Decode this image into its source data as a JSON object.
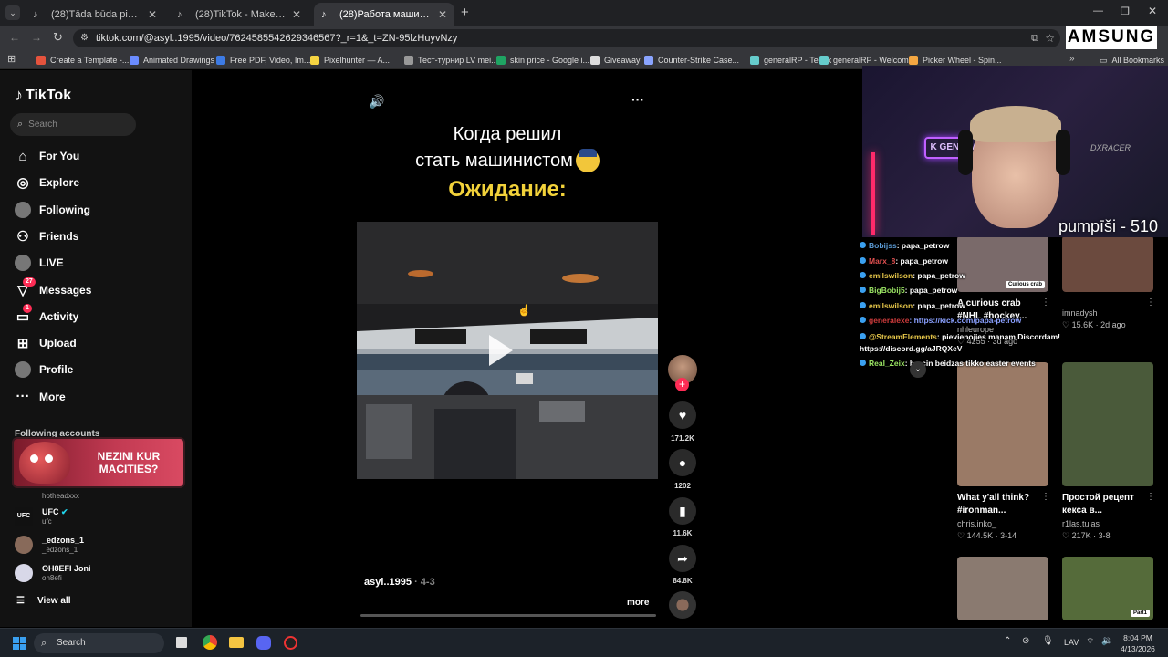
{
  "browser": {
    "tabs": [
      {
        "title": "(28)Tāda būda pienāca #fyp #v",
        "active": false
      },
      {
        "title": "(28)TikTok - Make Your Day",
        "active": false
      },
      {
        "title": "(28)Работа машиниста: реаль",
        "active": true
      }
    ],
    "url": "tiktok.com/@asyl..1995/video/7624585542629346567?_r=1&_t=ZN-95lzHuyvNzy",
    "bookmarks": [
      {
        "label": "Create a Template -...",
        "color": "#e5533d"
      },
      {
        "label": "Animated Drawings",
        "color": "#6b8cff"
      },
      {
        "label": "Free PDF, Video, Im...",
        "color": "#3d7be5"
      },
      {
        "label": "Pixelhunter — A...",
        "color": "#f5d442"
      },
      {
        "label": "Тест-турнир LV mei...",
        "color": "#999"
      },
      {
        "label": "skin price - Google i...",
        "color": "#1fa463"
      },
      {
        "label": "Giveaway",
        "color": "#ddd"
      },
      {
        "label": "Counter-Strike Case...",
        "color": "#8aa4ff"
      },
      {
        "label": "generalRP - Tebex",
        "color": "#6cc"
      },
      {
        "label": "generalRP - Welcome",
        "color": "#6cc"
      },
      {
        "label": "Picker Wheel - Spin...",
        "color": "#f5a742"
      }
    ],
    "all_bookmarks": "All Bookmarks"
  },
  "tiktok": {
    "logo": "TikTok",
    "search_placeholder": "Search",
    "nav": [
      {
        "label": "For You",
        "icon": "home-icon",
        "glyph": "⌂"
      },
      {
        "label": "Explore",
        "icon": "compass-icon",
        "glyph": "◎"
      },
      {
        "label": "Following",
        "icon": "following-avatar-icon",
        "glyph": "●"
      },
      {
        "label": "Friends",
        "icon": "friends-icon",
        "glyph": "⚇"
      },
      {
        "label": "LIVE",
        "icon": "live-avatar-icon",
        "glyph": "●"
      },
      {
        "label": "Messages",
        "icon": "messages-icon",
        "glyph": "▽",
        "badge": "27"
      },
      {
        "label": "Activity",
        "icon": "activity-icon",
        "glyph": "▭",
        "badge": "1"
      },
      {
        "label": "Upload",
        "icon": "upload-icon",
        "glyph": "⊞"
      },
      {
        "label": "Profile",
        "icon": "profile-avatar-icon",
        "glyph": "●"
      },
      {
        "label": "More",
        "icon": "more-dots-icon",
        "glyph": "···"
      }
    ],
    "following_header": "Following accounts",
    "ad_banner": "NEZINI KUR MĀCĪTIES?",
    "accounts": [
      {
        "name": "",
        "handle": "hotheadxxx"
      },
      {
        "name": "UFC",
        "handle": "ufc",
        "verified": true
      },
      {
        "name": "_edzons_1",
        "handle": "_edzons_1"
      },
      {
        "name": "OH8EFI Joni",
        "handle": "oh8efi"
      }
    ],
    "view_all": "View all",
    "video": {
      "caption_line1": "Когда решил",
      "caption_line2": "стать машинистом",
      "caption_line3": "Ожидание:",
      "author": "asyl..1995",
      "date": "· 4-3",
      "more": "more"
    },
    "actions": {
      "likes": "171.2K",
      "comments": "1202",
      "saves": "11.6K",
      "shares": "84.8K"
    },
    "recommended": [
      {
        "title": "A curious crab #NHL #hockey...",
        "author": "nhleurope",
        "views": "4255",
        "date": "3d ago",
        "label": "Curious crab",
        "color": "#7a6a6a"
      },
      {
        "title": "",
        "author": "imnadysh",
        "views": "15.6K",
        "date": "2d ago",
        "color": "#6b4a3e"
      },
      {
        "title": "What y'all think? #ironman...",
        "author": "chris.inko_",
        "views": "144.5K",
        "date": "3-14",
        "color": "#9a7a66"
      },
      {
        "title": "Простой рецепт кекса в...",
        "author": "r1las.tulas",
        "views": "217K",
        "date": "3-8",
        "color": "#4a5a3a"
      },
      {
        "title": "",
        "author": "",
        "views": "",
        "date": "",
        "color": "#8a7a70"
      },
      {
        "title": "",
        "author": "",
        "views": "",
        "date": "",
        "label": "Part1",
        "color": "#556b3a"
      }
    ]
  },
  "stream": {
    "overlay_text": "pumpīši - 510",
    "brand": "AMSUNG",
    "chat": [
      {
        "user": "Bobijss",
        "msg": ": papa_petrow",
        "color": "#5b9bd5"
      },
      {
        "user": "Marx_8",
        "msg": ": papa_petrow",
        "color": "#e05050"
      },
      {
        "user": "emilswilson",
        "msg": ": papa_petrow",
        "color": "#e8c84a"
      },
      {
        "user": "BigBobij5",
        "msg": ": papa_petrow",
        "color": "#9be564"
      },
      {
        "user": "emilswilson",
        "msg": ": papa_petrow",
        "color": "#e8c84a"
      },
      {
        "user": "generalexe",
        "msg": ": https://kick.com/papa-petrow",
        "color": "#d03c3c"
      },
      {
        "user": "@StreamElements",
        "msg": ": pievienojies manam Discordam! https://discord.gg/aJRQXeV",
        "color": "#e8c84a"
      },
      {
        "user": "Real_Zeix",
        "msg": ": bracin beidzas tikko easter events",
        "color": "#9be564"
      }
    ]
  },
  "taskbar": {
    "search": "Search",
    "language": "LAV",
    "time": "8:04 PM",
    "date": "4/13/2026"
  }
}
